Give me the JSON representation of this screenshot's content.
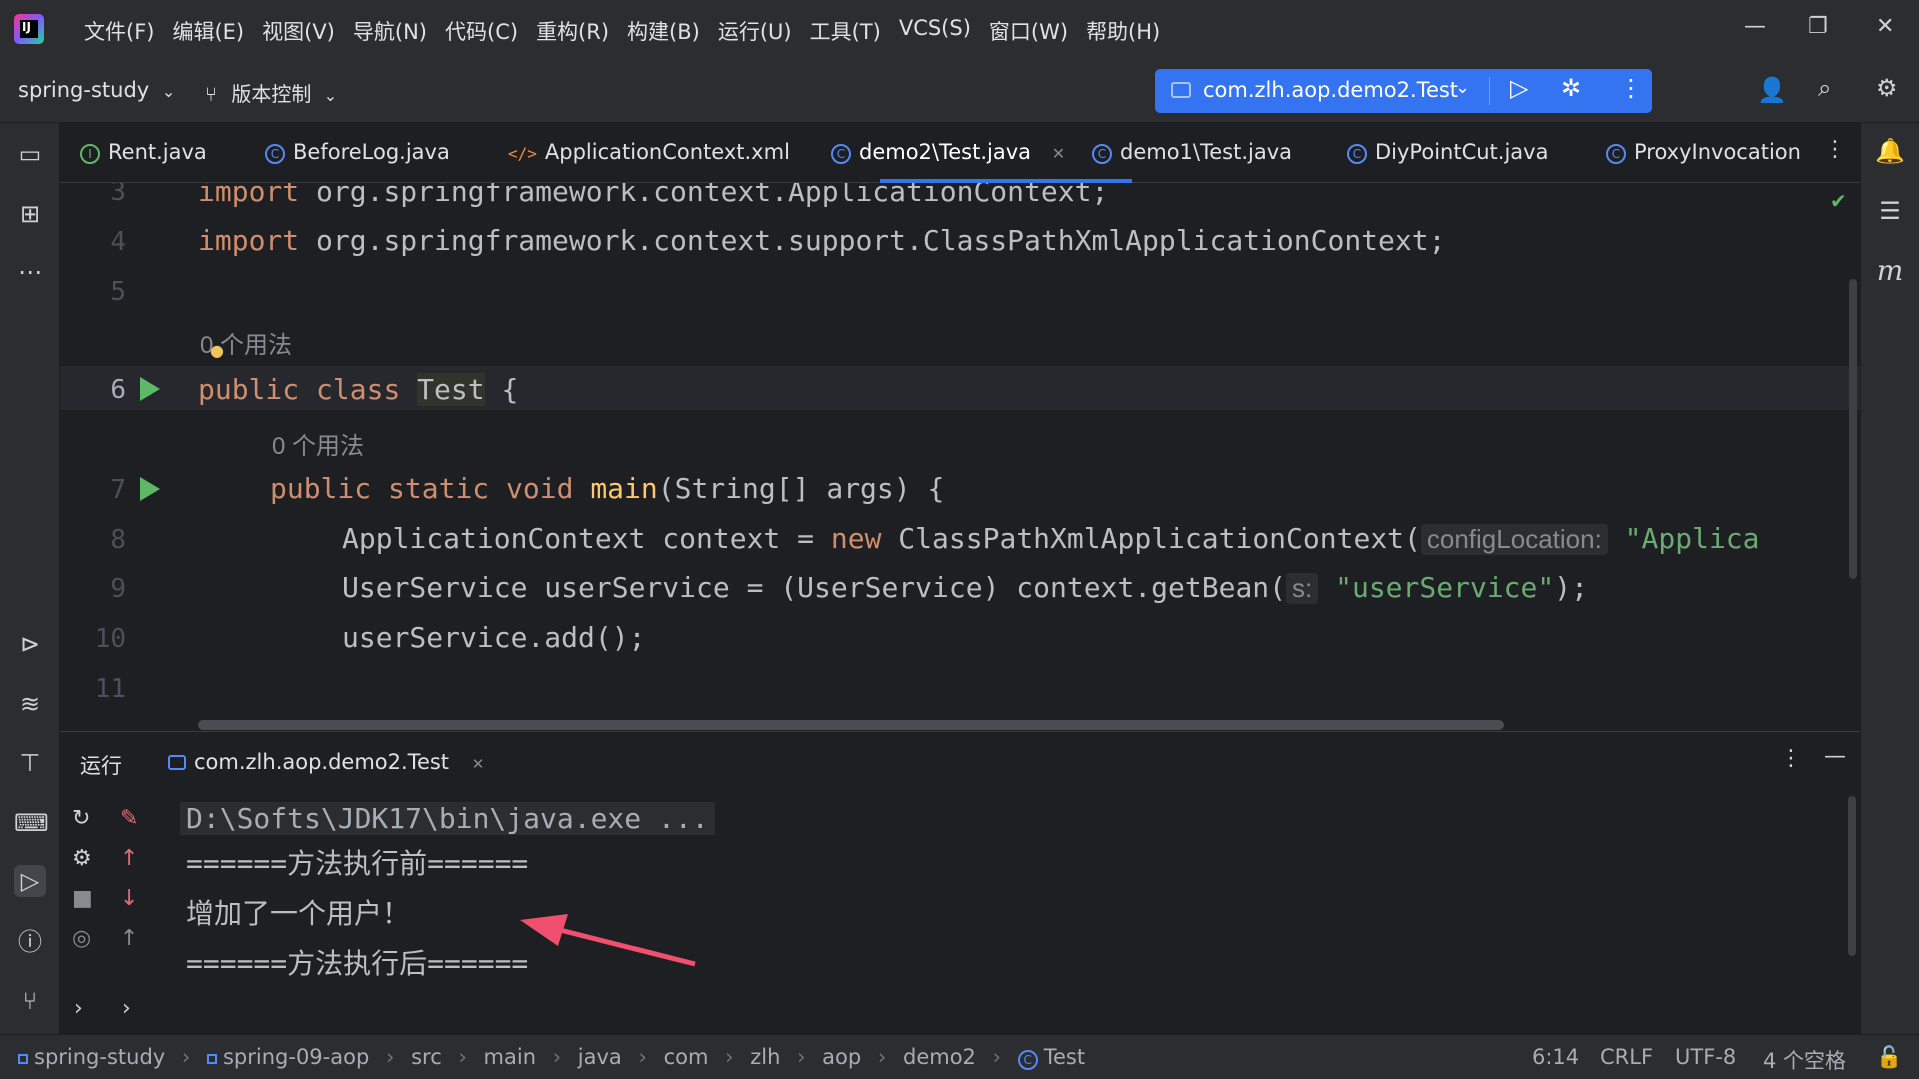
{
  "menu": [
    "文件(F)",
    "编辑(E)",
    "视图(V)",
    "导航(N)",
    "代码(C)",
    "重构(R)",
    "构建(B)",
    "运行(U)",
    "工具(T)",
    "VCS(S)",
    "窗口(W)",
    "帮助(H)"
  ],
  "toolbar": {
    "project": "spring-study",
    "vcs": "版本控制",
    "run_config": "com.zlh.aop.demo2.Test"
  },
  "tabs": [
    {
      "label": "Rent.java"
    },
    {
      "label": "BeforeLog.java"
    },
    {
      "label": "ApplicationContext.xml"
    },
    {
      "label": "demo2\\Test.java"
    },
    {
      "label": "demo1\\Test.java"
    },
    {
      "label": "DiyPointCut.java"
    },
    {
      "label": "ProxyInvocation"
    }
  ],
  "editor": {
    "line_numbers": [
      "3",
      "4",
      "5",
      "6",
      "7",
      "8",
      "9",
      "10",
      "11"
    ],
    "usage_hints": [
      "0 个用法",
      "0 个用法"
    ],
    "lines": {
      "l3": {
        "kw": "import",
        "rest": " org.springframework.context.ApplicationContext;"
      },
      "l4": {
        "kw": "import",
        "rest": " org.springframework.context.support.ClassPathXmlApplicationContext;"
      },
      "l6": {
        "kw1": "public",
        "kw2": "class",
        "name": "Test",
        "rest": " {"
      },
      "l7": {
        "kw1": "public",
        "kw2": "static",
        "kw3": "void",
        "fn": "main",
        "rest": "(String[] args) {"
      },
      "l8": {
        "pre": "ApplicationContext context = ",
        "kw": "new",
        "post": " ClassPathXmlApplicationContext(",
        "hint": "configLocation:",
        "str": "\"Applica"
      },
      "l9": {
        "pre": "UserService userService = (UserService) context.getBean(",
        "hint": "s:",
        "str": "\"userService\"",
        "post": ");"
      },
      "l10": {
        "pre": "userService.add();"
      }
    }
  },
  "run_panel": {
    "title": "运行",
    "tab": "com.zlh.aop.demo2.Test",
    "console": [
      "D:\\Softs\\JDK17\\bin\\java.exe ...",
      "======方法执行前======",
      "增加了一个用户！",
      "======方法执行后======"
    ]
  },
  "statusbar": {
    "breadcrumbs": [
      "spring-study",
      "spring-09-aop",
      "src",
      "main",
      "java",
      "com",
      "zlh",
      "aop",
      "demo2",
      "Test"
    ],
    "position": "6:14",
    "line_sep": "CRLF",
    "encoding": "UTF-8",
    "indent": "4 个空格"
  },
  "colors": {
    "accent": "#3574f0",
    "run_green": "#5fb865",
    "annotation_arrow": "#f0506e"
  }
}
